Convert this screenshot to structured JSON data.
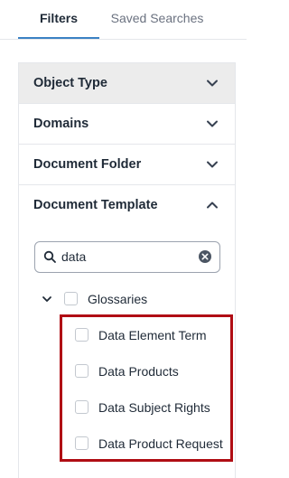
{
  "tabs": {
    "filters": "Filters",
    "saved_searches": "Saved Searches"
  },
  "accordion": [
    {
      "label": "Object Type",
      "expanded": false
    },
    {
      "label": "Domains",
      "expanded": false
    },
    {
      "label": "Document Folder",
      "expanded": false
    },
    {
      "label": "Document Template",
      "expanded": true
    }
  ],
  "search": {
    "value": "data",
    "placeholder": "Search"
  },
  "tree": {
    "parent": {
      "label": "Glossaries",
      "checked": false,
      "expanded": true
    },
    "children": [
      {
        "label": "Data Element Term",
        "checked": false
      },
      {
        "label": "Data Products",
        "checked": false
      },
      {
        "label": "Data Subject Rights",
        "checked": false
      },
      {
        "label": "Data Product Request",
        "checked": false
      }
    ]
  },
  "colors": {
    "accent": "#3b82c4",
    "highlight_border": "#b00d14",
    "header_bg": "#ececec"
  }
}
